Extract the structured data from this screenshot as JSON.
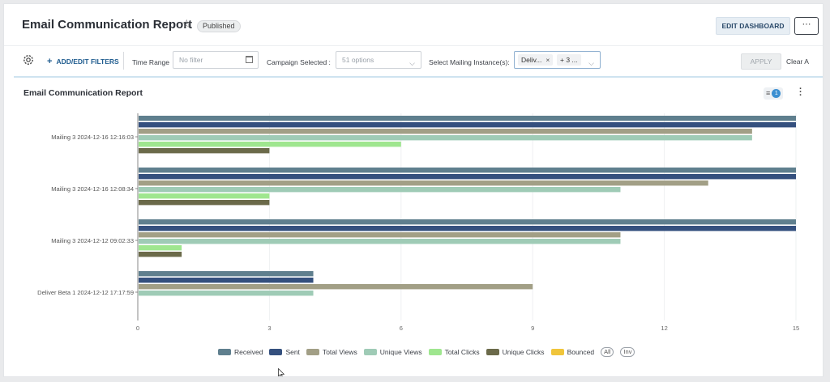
{
  "header": {
    "title": "Email Communication Report",
    "status": "Published",
    "edit_label": "EDIT DASHBOARD",
    "more_label": "···"
  },
  "filters": {
    "add_label": "ADD/EDIT FILTERS",
    "time_range_label": "Time Range",
    "time_range_placeholder": "No filter",
    "campaign_label": "Campaign Selected :",
    "campaign_value": "51 options",
    "mailing_label": "Select Mailing Instance(s):",
    "mailing_chip_1": "Deliv...",
    "mailing_chip_2": "+ 3 ...",
    "apply_label": "APPLY",
    "clear_label": "Clear A"
  },
  "panel": {
    "title": "Email Communication Report",
    "filter_count": "1"
  },
  "chart_data": {
    "type": "bar",
    "orientation": "horizontal",
    "categories": [
      "Mailing 3 2024-12-16 12:16:03",
      "Mailing 3 2024-12-16 12:08:34",
      "Mailing 3 2024-12-12 09:02:33",
      "Deliver Beta 1 2024-12-12 17:17:59"
    ],
    "series": [
      {
        "name": "Received",
        "color": "#5f7f8e",
        "values": [
          15,
          15,
          15,
          4
        ]
      },
      {
        "name": "Sent",
        "color": "#34507e",
        "values": [
          15,
          15,
          15,
          4
        ]
      },
      {
        "name": "Total Views",
        "color": "#a29f86",
        "values": [
          14,
          13,
          11,
          9
        ]
      },
      {
        "name": "Unique Views",
        "color": "#9fcbb6",
        "values": [
          14,
          11,
          11,
          4
        ]
      },
      {
        "name": "Total Clicks",
        "color": "#9fe68f",
        "values": [
          6,
          3,
          1,
          0
        ]
      },
      {
        "name": "Unique Clicks",
        "color": "#6b6a4a",
        "values": [
          3,
          3,
          1,
          0
        ]
      },
      {
        "name": "Bounced",
        "color": "#f0c53b",
        "values": [
          0,
          0,
          0,
          0
        ]
      }
    ],
    "x_ticks": [
      "0",
      "3",
      "6",
      "9",
      "12",
      "15"
    ],
    "xlim": [
      0,
      15
    ],
    "grid": true,
    "legend_position": "bottom",
    "legend_extras": [
      "All",
      "Inv"
    ]
  }
}
